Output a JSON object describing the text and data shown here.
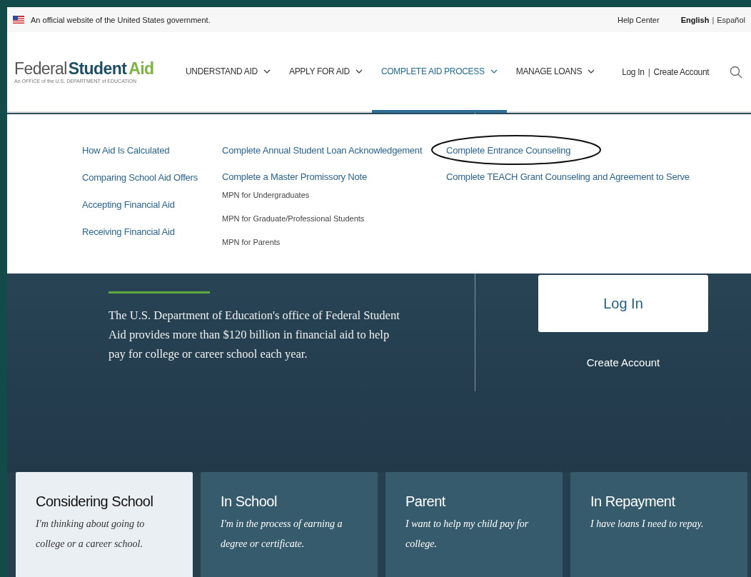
{
  "gov_banner": {
    "text": "An official website of the United States government.",
    "help_link": "Help Center",
    "languages": [
      {
        "label": "English",
        "selected": true
      },
      {
        "label": "Español",
        "selected": false
      }
    ],
    "language_separator": "|"
  },
  "header": {
    "logo": {
      "light": "Federal",
      "bold": "Student",
      "accent": "Aid",
      "tagline": "An OFFICE of the U.S. DEPARTMENT of EDUCATION"
    },
    "nav": [
      {
        "label": "UNDERSTAND AID",
        "selected": false
      },
      {
        "label": "APPLY FOR AID",
        "selected": false
      },
      {
        "label": "COMPLETE AID PROCESS",
        "selected": true
      },
      {
        "label": "MANAGE LOANS",
        "selected": false
      }
    ],
    "account_links": [
      "Log In",
      "Create Account"
    ],
    "account_separator": "|"
  },
  "dropdown": {
    "columns": [
      [
        {
          "label": "How Aid Is Calculated",
          "kind": "link",
          "circled": false
        },
        {
          "label": "Comparing School Aid Offers",
          "kind": "link",
          "circled": false
        },
        {
          "label": "Accepting Financial Aid",
          "kind": "link",
          "circled": false
        },
        {
          "label": "Receiving Financial Aid",
          "kind": "link",
          "circled": false
        }
      ],
      [
        {
          "label": "Complete Annual Student Loan Acknowledgement",
          "kind": "link",
          "circled": false
        },
        {
          "label": "Complete a Master Promissory Note",
          "kind": "link",
          "circled": false
        },
        {
          "label": "MPN for Undergraduates",
          "kind": "sublink",
          "circled": false
        },
        {
          "label": "MPN for Graduate/Professional Students",
          "kind": "sublink",
          "circled": false
        },
        {
          "label": "MPN for Parents",
          "kind": "sublink",
          "circled": false
        }
      ],
      [
        {
          "label": "Complete Entrance Counseling",
          "kind": "link",
          "circled": true
        },
        {
          "label": "Complete TEACH Grant Counseling and Agreement to Serve",
          "kind": "link",
          "circled": false
        }
      ]
    ]
  },
  "hero": {
    "text": "The U.S. Department of Education's office of Federal Student Aid provides more than $120 billion in financial aid to help pay for college or career school each year.",
    "login_button": "Log In",
    "create_account": "Create Account"
  },
  "cards": [
    {
      "title": "Considering School",
      "text": "I'm thinking about going to college or a career school.",
      "selected": true
    },
    {
      "title": "In School",
      "text": "I'm in the process of earning a degree or certificate.",
      "selected": false
    },
    {
      "title": "Parent",
      "text": "I want to help my child pay for college.",
      "selected": false
    },
    {
      "title": "In Repayment",
      "text": "I have loans I need to repay.",
      "selected": false
    }
  ]
}
